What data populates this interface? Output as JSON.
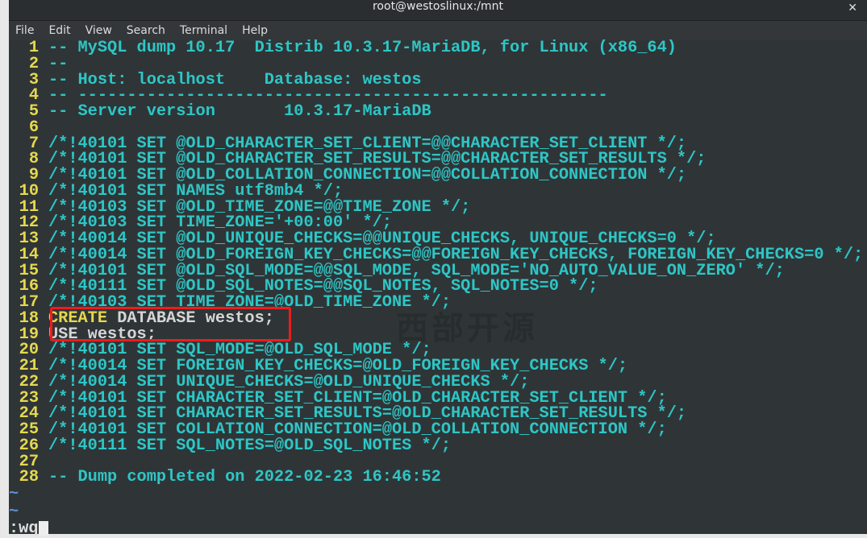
{
  "window": {
    "title": "root@westoslinux:/mnt",
    "close_icon": "close-icon"
  },
  "menu": [
    "File",
    "Edit",
    "View",
    "Search",
    "Terminal",
    "Help"
  ],
  "lines": [
    {
      "n": "1",
      "t": "-- MySQL dump 10.17  Distrib 10.3.17-MariaDB, for Linux (x86_64)"
    },
    {
      "n": "2",
      "t": "--"
    },
    {
      "n": "3",
      "t": "-- Host: localhost    Database: westos"
    },
    {
      "n": "4",
      "t": "-- ------------------------------------------------------"
    },
    {
      "n": "5",
      "t": "-- Server version       10.3.17-MariaDB"
    },
    {
      "n": "6",
      "t": ""
    },
    {
      "n": "7",
      "t": "/*!40101 SET @OLD_CHARACTER_SET_CLIENT=@@CHARACTER_SET_CLIENT */;"
    },
    {
      "n": "8",
      "t": "/*!40101 SET @OLD_CHARACTER_SET_RESULTS=@@CHARACTER_SET_RESULTS */;"
    },
    {
      "n": "9",
      "t": "/*!40101 SET @OLD_COLLATION_CONNECTION=@@COLLATION_CONNECTION */;"
    },
    {
      "n": "10",
      "t": "/*!40101 SET NAMES utf8mb4 */;"
    },
    {
      "n": "11",
      "t": "/*!40103 SET @OLD_TIME_ZONE=@@TIME_ZONE */;"
    },
    {
      "n": "12",
      "t": "/*!40103 SET TIME_ZONE='+00:00' */;"
    },
    {
      "n": "13",
      "t": "/*!40014 SET @OLD_UNIQUE_CHECKS=@@UNIQUE_CHECKS, UNIQUE_CHECKS=0 */;"
    },
    {
      "n": "14",
      "t": "/*!40014 SET @OLD_FOREIGN_KEY_CHECKS=@@FOREIGN_KEY_CHECKS, FOREIGN_KEY_CHECKS=0 */;"
    },
    {
      "n": "15",
      "t": "/*!40101 SET @OLD_SQL_MODE=@@SQL_MODE, SQL_MODE='NO_AUTO_VALUE_ON_ZERO' */;"
    },
    {
      "n": "16",
      "t": "/*!40111 SET @OLD_SQL_NOTES=@@SQL_NOTES, SQL_NOTES=0 */;"
    },
    {
      "n": "17",
      "t": "/*!40103 SET TIME_ZONE=@OLD_TIME_ZONE */;"
    },
    {
      "n": "18",
      "kw": "CREATE",
      "t": " DATABASE westos;"
    },
    {
      "n": "19",
      "t": "USE westos;"
    },
    {
      "n": "20",
      "t": "/*!40101 SET SQL_MODE=@OLD_SQL_MODE */;"
    },
    {
      "n": "21",
      "t": "/*!40014 SET FOREIGN_KEY_CHECKS=@OLD_FOREIGN_KEY_CHECKS */;"
    },
    {
      "n": "22",
      "t": "/*!40014 SET UNIQUE_CHECKS=@OLD_UNIQUE_CHECKS */;"
    },
    {
      "n": "23",
      "t": "/*!40101 SET CHARACTER_SET_CLIENT=@OLD_CHARACTER_SET_CLIENT */;"
    },
    {
      "n": "24",
      "t": "/*!40101 SET CHARACTER_SET_RESULTS=@OLD_CHARACTER_SET_RESULTS */;"
    },
    {
      "n": "25",
      "t": "/*!40101 SET COLLATION_CONNECTION=@OLD_COLLATION_CONNECTION */;"
    },
    {
      "n": "26",
      "t": "/*!40111 SET SQL_NOTES=@OLD_SQL_NOTES */;"
    },
    {
      "n": "27",
      "t": ""
    },
    {
      "n": "28",
      "t": "-- Dump completed on 2022-02-23 16:46:52"
    }
  ],
  "tilde": "~",
  "command": ":wq",
  "watermark": "西部开源",
  "colors": {
    "line_number": "#e6d84d",
    "comment": "#2ec6c6",
    "plain": "#d6d6d6",
    "highlight_box": "#ee1c1c"
  }
}
